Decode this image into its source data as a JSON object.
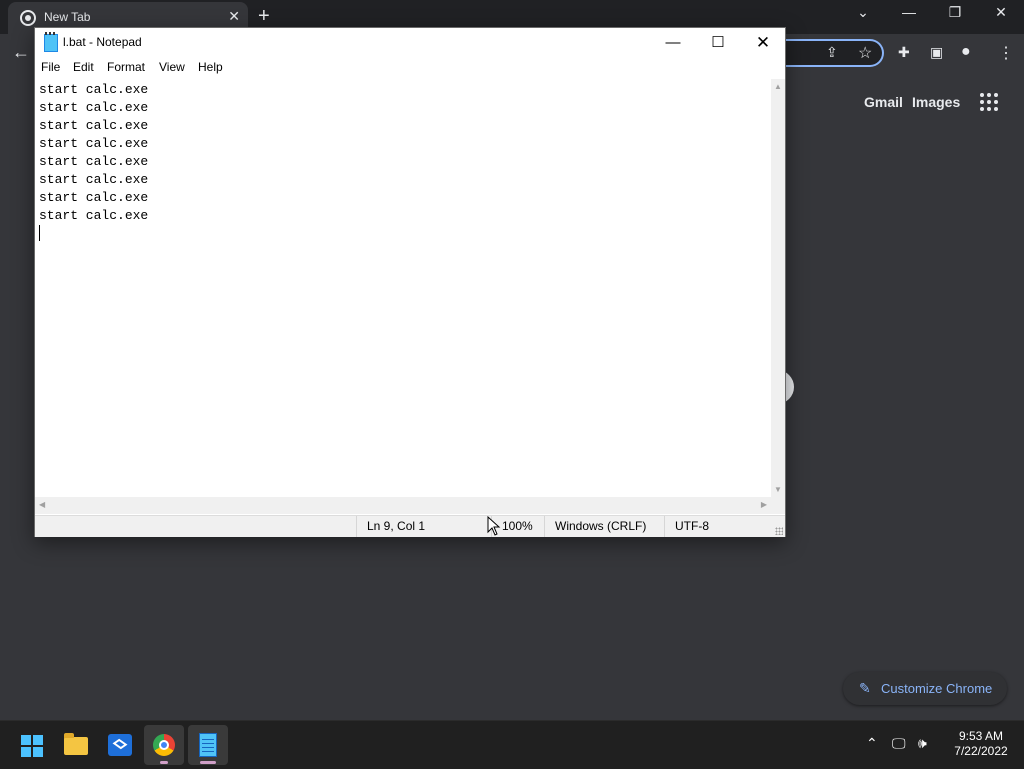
{
  "chrome": {
    "tab_title": "New Tab",
    "close_tab": "✕",
    "new_tab": "+",
    "links": {
      "gmail": "Gmail",
      "images": "Images"
    },
    "customize_label": "Customize Chrome"
  },
  "notepad": {
    "title": "l.bat - Notepad",
    "menu": [
      "File",
      "Edit",
      "Format",
      "View",
      "Help"
    ],
    "content": "start calc.exe\nstart calc.exe\nstart calc.exe\nstart calc.exe\nstart calc.exe\nstart calc.exe\nstart calc.exe\nstart calc.exe",
    "status": {
      "position": "Ln 9, Col 1",
      "zoom": "100%",
      "line_endings": "Windows (CRLF)",
      "encoding": "UTF-8"
    }
  },
  "taskbar": {
    "apps": [
      "start-icon",
      "file-explorer-icon",
      "store-icon",
      "chrome-icon",
      "notepad-icon"
    ],
    "time": "9:53 AM",
    "date": "7/22/2022"
  },
  "colors": {
    "chrome_bg": "#35363a",
    "accent": "#8ab4f8",
    "taskbar": "#202020"
  }
}
